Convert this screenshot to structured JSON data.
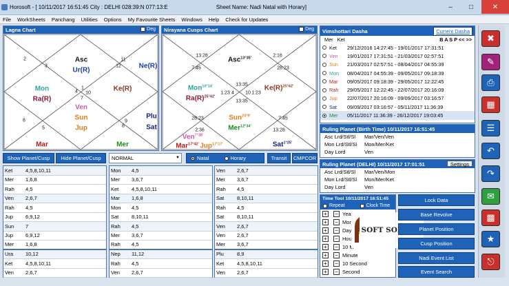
{
  "window": {
    "title": "Horosoft - [ 10/11/2017 16:51:45 City : DELHI 028:39:N 077:13:E",
    "sheet": "Sheet Name: Nadi Natal with Horary]"
  },
  "menu": [
    "File",
    "WorkSheets",
    "Panchang",
    "Utilities",
    "Options",
    "My Favourite Sheets",
    "Windows",
    "Help",
    "Check for Updates"
  ],
  "lagna": {
    "title": "Lagna Chart",
    "deg_label": "Deg",
    "houses": [
      "3",
      "2",
      "12",
      "11",
      "4",
      "1",
      "10",
      "7",
      "5",
      "6",
      "8",
      "9"
    ],
    "planets": {
      "asc": "Asc",
      "ur": "Ur(R)",
      "ne": "Ne(R)",
      "mon": "Mon",
      "ra": "Ra(R)",
      "ke": "Ke(R)",
      "ven": "Ven",
      "sun": "Sun",
      "jup": "Jup",
      "plu": "Plu",
      "sat": "Sat",
      "mar": "Mar",
      "mer": "Mer"
    }
  },
  "nirayana": {
    "title": "Nirayana Cusps Chart",
    "deg_label": "Deg",
    "cusps": [
      "13:28",
      "7:45",
      "2:16",
      "28:23",
      "1:23",
      "13:35",
      "1:23",
      "4",
      "13:35",
      "10",
      "28:23",
      "2:36",
      "7:45",
      "13:28"
    ],
    "planets": [
      {
        "name": "Asc",
        "deg": "13°35'"
      },
      {
        "name": "Mon",
        "deg": "10°14'"
      },
      {
        "name": "Ra(R)",
        "deg": "25°42'"
      },
      {
        "name": "Ke(R)",
        "deg": "25°42'"
      },
      {
        "name": "Sun",
        "deg": "24°9'"
      },
      {
        "name": "Mer",
        "deg": "12°34'"
      },
      {
        "name": "Ven",
        "deg": "7°38'"
      },
      {
        "name": "Mar",
        "deg": "17°42'"
      },
      {
        "name": "Jup",
        "deg": "17°17'"
      },
      {
        "name": "Sat",
        "deg": "1°25'"
      }
    ]
  },
  "controls": {
    "show_planet": "Show Planet/Cusp",
    "hide_planet": "Hide Planet/Cusp",
    "chart_type": "NORMAL",
    "natal": "Natal",
    "horary": "Horary",
    "transit": "Transit",
    "cmpcor": "CMPCOR"
  },
  "sig_tables": [
    [
      {
        "k": "Ket",
        "v": "4,5,8,10,11"
      },
      {
        "k": "Mer",
        "v": "1,6,8"
      },
      {
        "k": "Rah",
        "v": "4,5"
      },
      {
        "k": "Ven",
        "v": "2,6,7"
      },
      {
        "k": "Rah",
        "v": "4,5"
      },
      {
        "k": "Jup",
        "v": "6,9,12"
      },
      {
        "k": "Sun",
        "v": "7"
      },
      {
        "k": "Jup",
        "v": "6,9,12"
      },
      {
        "k": "Mer",
        "v": "1,6,8"
      },
      {
        "k": "Ura",
        "v": "10,12"
      },
      {
        "k": "Ket",
        "v": "4,5,8,10,11"
      },
      {
        "k": "Ven",
        "v": "2,6,7"
      }
    ],
    [
      {
        "k": "Mon",
        "v": "4,5"
      },
      {
        "k": "Mer",
        "v": "3,6,7"
      },
      {
        "k": "Ket",
        "v": "4,5,8,10,11"
      },
      {
        "k": "Mar",
        "v": "1,6,8"
      },
      {
        "k": "Mon",
        "v": "4,5"
      },
      {
        "k": "Sat",
        "v": "8,10,11"
      },
      {
        "k": "Rah",
        "v": "4,5"
      },
      {
        "k": "Mer",
        "v": "3,6,7"
      },
      {
        "k": "Rah",
        "v": "4,5"
      },
      {
        "k": "Nep",
        "v": "11,12"
      },
      {
        "k": "Rah",
        "v": "4,5"
      },
      {
        "k": "Ven",
        "v": "2,6,7"
      }
    ],
    [
      {
        "k": "Ven",
        "v": "2,6,7"
      },
      {
        "k": "Mer",
        "v": "3,6,7"
      },
      {
        "k": "Rah",
        "v": "4,5"
      },
      {
        "k": "Sat",
        "v": "8,10,11"
      },
      {
        "k": "Rah",
        "v": "4,5"
      },
      {
        "k": "Sat",
        "v": "8,10,11"
      },
      {
        "k": "Ven",
        "v": "2,6,7"
      },
      {
        "k": "Ven",
        "v": "2,6,7"
      },
      {
        "k": "Mer",
        "v": "3,6,7"
      },
      {
        "k": "Plu",
        "v": "8,9"
      },
      {
        "k": "Ket",
        "v": "4,5,8,10,11"
      },
      {
        "k": "Ven",
        "v": "2,6,7"
      }
    ]
  ],
  "dasha": {
    "title": "Vimshottari Dasha",
    "current_btn": "Current Dasha",
    "nav": "B A S P << >>",
    "header": [
      "Mer",
      "Ket"
    ],
    "rows": [
      {
        "p": "Ket",
        "d": "29/12/2016 14:27:45 - 19/01/2017 17:31:51",
        "c": "#111111"
      },
      {
        "p": "Ven",
        "d": "19/01/2017 17:31:51 - 21/03/2017 02:57:51",
        "c": "#d05aa8"
      },
      {
        "p": "Sun",
        "d": "21/03/2017 02:57:51 - 08/04/2017 04:55:39",
        "c": "#e07b1b"
      },
      {
        "p": "Mon",
        "d": "08/04/2017 04:55:39 - 09/05/2017 09:18:39",
        "c": "#2aa4a0"
      },
      {
        "p": "Mar",
        "d": "09/05/2017 09:18:39 - 29/05/2017 12:22:45",
        "c": "#b81a1a"
      },
      {
        "p": "Rah",
        "d": "29/05/2017 12:22:45 - 22/07/2017 20:16:09",
        "c": "#8b3b25"
      },
      {
        "p": "Jup",
        "d": "22/07/2017 20:16:09 - 09/09/2017 03:16:57",
        "c": "#e07b1b"
      },
      {
        "p": "Sat",
        "d": "09/09/2017 03:16:57 - 05/11/2017 11:36:39",
        "c": "#101f78"
      },
      {
        "p": "Mer",
        "d": "05/11/2017 11:36:39 - 26/12/2017 19:03:45",
        "c": "#1f8a1f"
      }
    ]
  },
  "ruling_birth": {
    "title": "Ruling Planet (Birth Time) 10/11/2017 16:51:45",
    "rows": [
      {
        "k": "Asc Lrd/Stl/Sl",
        "v": "Mar/Ven/Ven"
      },
      {
        "k": "Mon Lrd/Stl/Sl",
        "v": "Mon/Mer/Ket"
      },
      {
        "k": "Day Lord",
        "v": "Ven"
      }
    ]
  },
  "ruling_delhi": {
    "title": "Ruling Planet (DELHI) 10/11/2017 17:01:51",
    "settings": "Settings",
    "rows": [
      {
        "k": "Asc Lrd/Stl/Sl",
        "v": "Mar/Ven/Mon"
      },
      {
        "k": "Mon Lrd/Stl/Sl",
        "v": "Mon/Mer/Ket"
      },
      {
        "k": "Day Lord",
        "v": "Ven"
      }
    ]
  },
  "time_tool": {
    "title": "Time Tool 10/11/2017 16:51:45",
    "repeat": "Repeat",
    "clock": "Clock Time",
    "rows": [
      "Year",
      "Month",
      "Day",
      "Hour",
      "10 M",
      "Minute",
      "10 Second",
      "Second"
    ]
  },
  "watermark": "SOFT SOLDIER",
  "buttons": [
    "Lock Data",
    "Base Revolve",
    "Planet Position",
    "Cusp Position",
    "Nadi Event List",
    "Event Search"
  ]
}
